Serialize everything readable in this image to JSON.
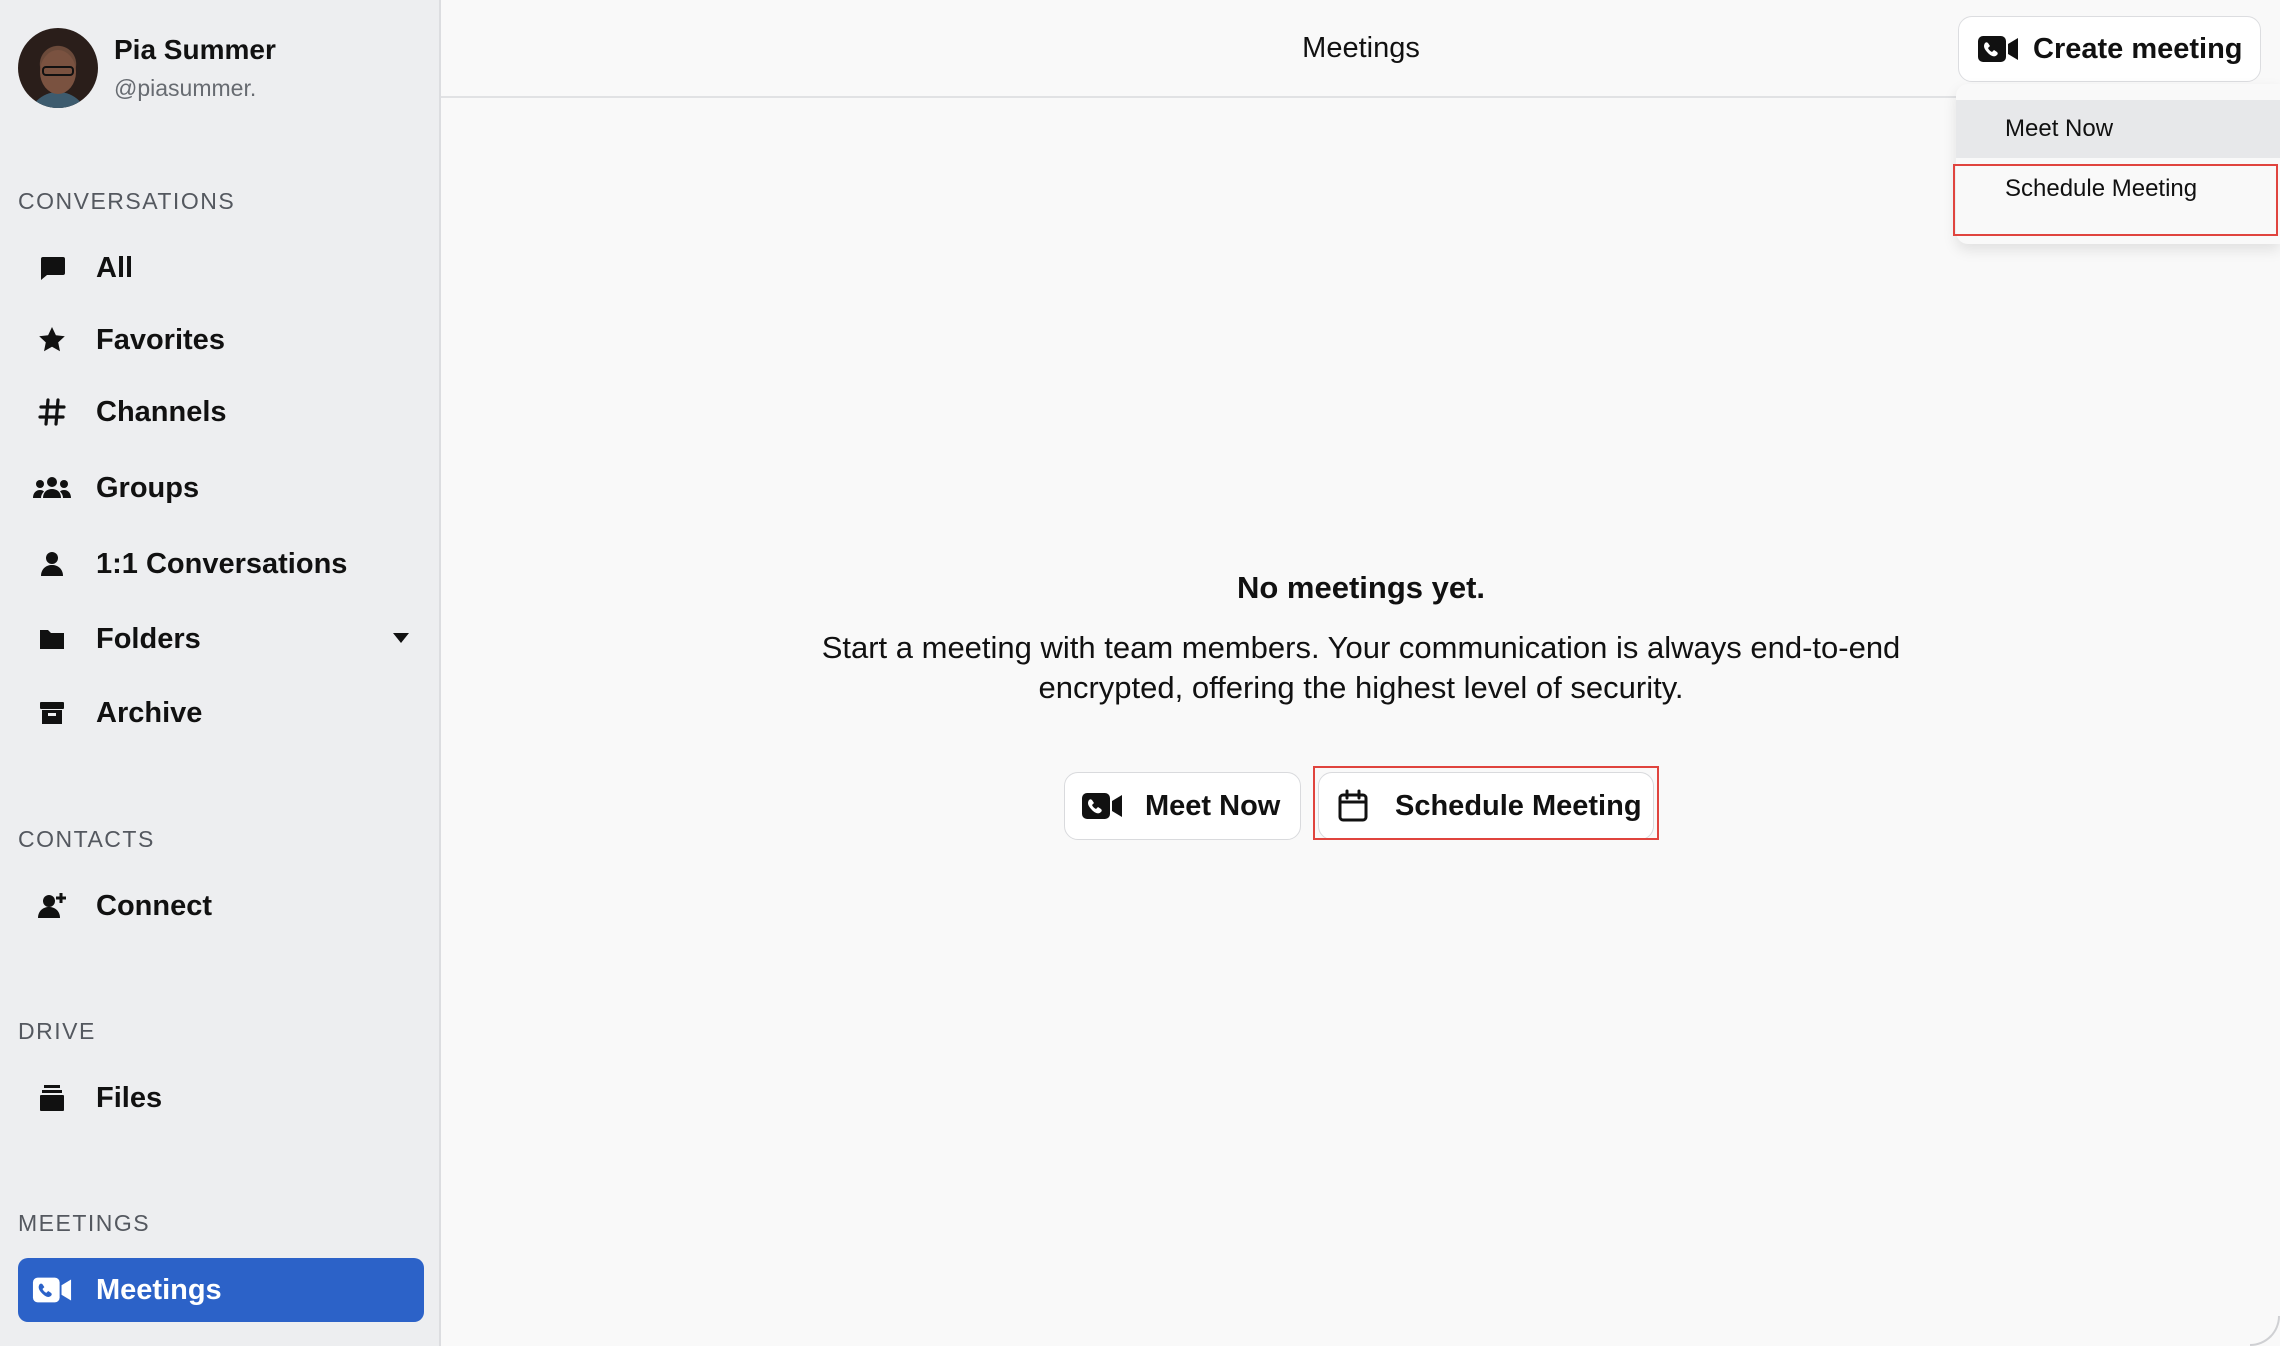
{
  "user": {
    "name": "Pia Summer",
    "handle": "@piasummer."
  },
  "sidebar": {
    "sections": {
      "conversations": "CONVERSATIONS",
      "contacts": "CONTACTS",
      "drive": "DRIVE",
      "meetings": "MEETINGS"
    },
    "items": {
      "all": "All",
      "favorites": "Favorites",
      "channels": "Channels",
      "groups": "Groups",
      "one_on_one": "1:1 Conversations",
      "folders": "Folders",
      "archive": "Archive",
      "connect": "Connect",
      "files": "Files",
      "meetings": "Meetings"
    },
    "active_item": "meetings"
  },
  "header": {
    "title": "Meetings",
    "create_label": "Create meeting"
  },
  "dropdown": {
    "items": [
      "Meet Now",
      "Schedule Meeting"
    ]
  },
  "empty_state": {
    "title": "No meetings yet.",
    "description": "Start a meeting with team members. Your communication is always end-to-end encrypted, offering the highest level of security."
  },
  "actions": {
    "meet_now": "Meet Now",
    "schedule": "Schedule Meeting"
  },
  "colors": {
    "accent": "#2c62c8",
    "highlight": "#e0443e",
    "sidebar_bg": "#edeef0"
  }
}
